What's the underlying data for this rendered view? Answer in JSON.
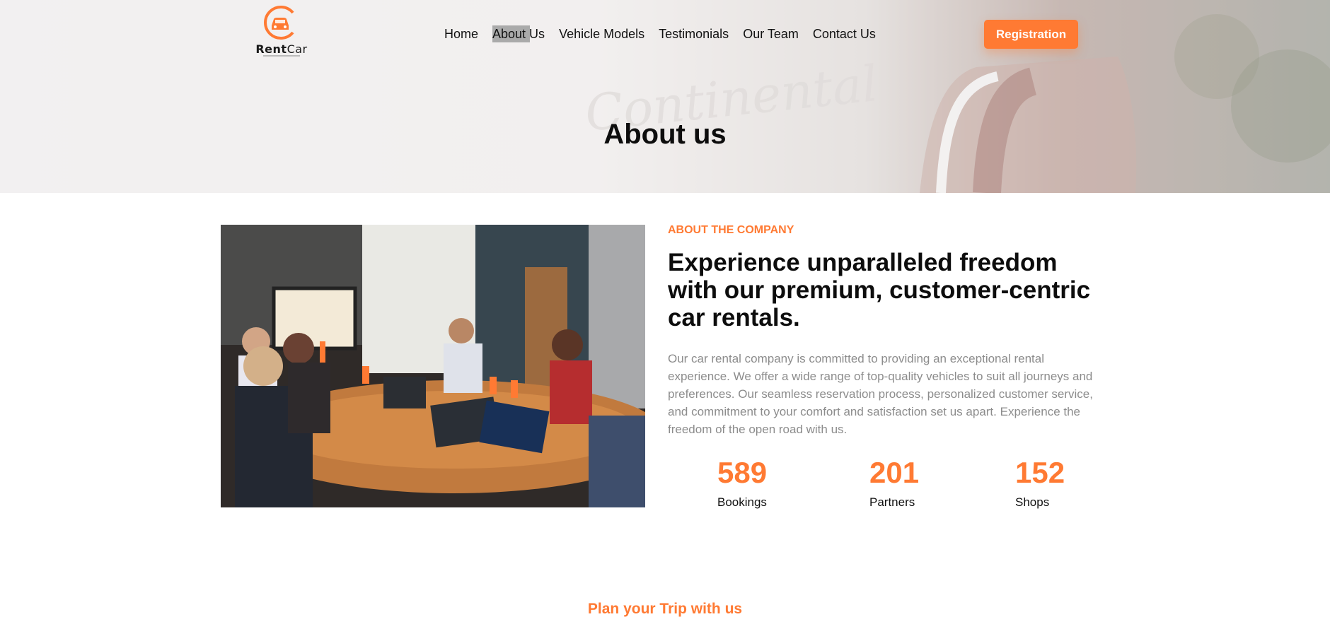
{
  "brand": {
    "name_bold": "Rent",
    "name_rest": "Car",
    "accent": "#ff7a33"
  },
  "nav": {
    "items": [
      "Home",
      "About Us",
      "Vehicle Models",
      "Testimonials",
      "Our Team",
      "Contact Us"
    ],
    "active": "About Us"
  },
  "header": {
    "registration_label": "Registration"
  },
  "hero": {
    "title": "About us"
  },
  "about": {
    "kicker": "ABOUT THE COMPANY",
    "headline": "Experience unparalleled freedom with our premium, customer-centric car rentals.",
    "description": "Our car rental company is committed to providing an exceptional rental experience. We offer a wide range of top-quality vehicles to suit all journeys and preferences. Our seamless reservation process, personalized customer service, and commitment to your comfort and satisfaction set us apart. Experience the freedom of the open road with us."
  },
  "stats": [
    {
      "value": "589",
      "label": "Bookings"
    },
    {
      "value": "201",
      "label": "Partners"
    },
    {
      "value": "152",
      "label": "Shops"
    }
  ],
  "plan": {
    "title": "Plan your Trip with us"
  }
}
